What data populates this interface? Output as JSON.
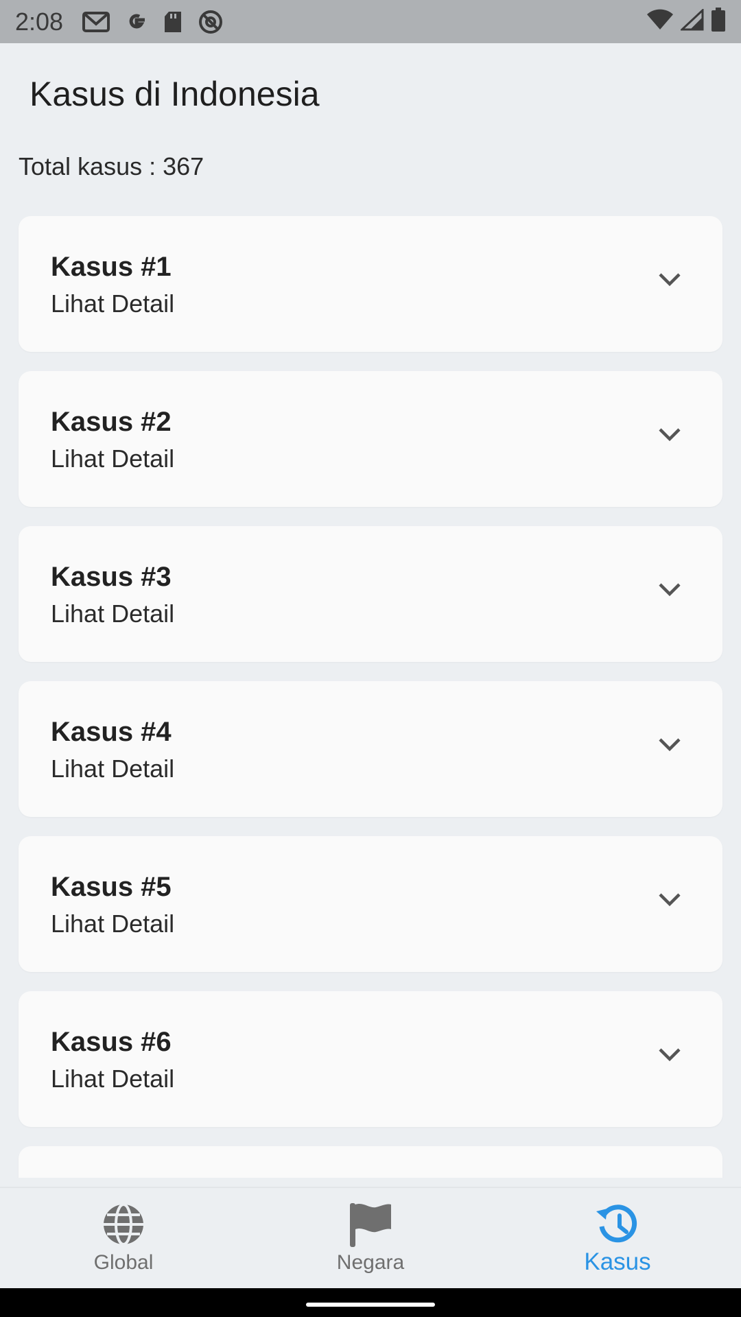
{
  "status_bar": {
    "time": "2:08",
    "left_icons": [
      "gmail-icon",
      "google-icon",
      "sd-card-icon",
      "at-sign-icon"
    ],
    "right_icons": [
      "wifi-icon",
      "signal-icon",
      "battery-icon"
    ]
  },
  "header": {
    "title": "Kasus di Indonesia"
  },
  "summary": {
    "label": "Total kasus : ",
    "value": "367"
  },
  "cases": [
    {
      "title": "Kasus #1",
      "subtitle": "Lihat Detail"
    },
    {
      "title": "Kasus #2",
      "subtitle": "Lihat Detail"
    },
    {
      "title": "Kasus #3",
      "subtitle": "Lihat Detail"
    },
    {
      "title": "Kasus #4",
      "subtitle": "Lihat Detail"
    },
    {
      "title": "Kasus #5",
      "subtitle": "Lihat Detail"
    },
    {
      "title": "Kasus #6",
      "subtitle": "Lihat Detail"
    },
    {
      "title": "",
      "subtitle": ""
    }
  ],
  "bottom_nav": {
    "items": [
      {
        "label": "Global",
        "icon": "globe-icon",
        "active": false
      },
      {
        "label": "Negara",
        "icon": "flag-icon",
        "active": false
      },
      {
        "label": "Kasus",
        "icon": "history-icon",
        "active": true
      }
    ],
    "active_color": "#2a93e4",
    "inactive_color": "#6f6f6f"
  }
}
